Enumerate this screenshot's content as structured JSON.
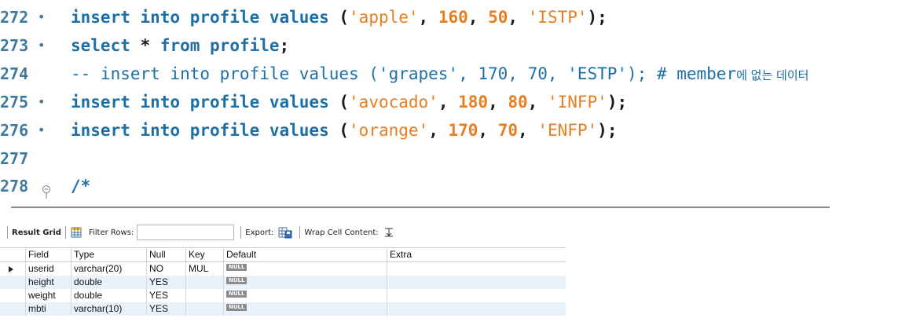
{
  "editor": {
    "lines": [
      {
        "number": "272",
        "marker": "•",
        "tokens": [
          {
            "t": "kw",
            "v": "insert into profile values "
          },
          {
            "t": "pn",
            "v": "("
          },
          {
            "t": "str",
            "v": "'apple'"
          },
          {
            "t": "pn",
            "v": ", "
          },
          {
            "t": "num",
            "v": "160"
          },
          {
            "t": "pn",
            "v": ", "
          },
          {
            "t": "num",
            "v": "50"
          },
          {
            "t": "pn",
            "v": ", "
          },
          {
            "t": "str",
            "v": "'ISTP'"
          },
          {
            "t": "pn",
            "v": ");"
          }
        ]
      },
      {
        "number": "273",
        "marker": "•",
        "tokens": [
          {
            "t": "kw",
            "v": "select "
          },
          {
            "t": "pn",
            "v": "* "
          },
          {
            "t": "kw",
            "v": "from profile"
          },
          {
            "t": "pn",
            "v": ";"
          }
        ]
      },
      {
        "number": "274",
        "marker": "",
        "tokens": [
          {
            "t": "cmt",
            "v": "-- insert into profile values ('grapes', 170, 70, 'ESTP'); # member"
          },
          {
            "t": "cmt-ko",
            "v": "에 없는 데이터"
          }
        ]
      },
      {
        "number": "275",
        "marker": "•",
        "tokens": [
          {
            "t": "kw",
            "v": "insert into profile values "
          },
          {
            "t": "pn",
            "v": "("
          },
          {
            "t": "str",
            "v": "'avocado'"
          },
          {
            "t": "pn",
            "v": ", "
          },
          {
            "t": "num",
            "v": "180"
          },
          {
            "t": "pn",
            "v": ", "
          },
          {
            "t": "num",
            "v": "80"
          },
          {
            "t": "pn",
            "v": ", "
          },
          {
            "t": "str",
            "v": "'INFP'"
          },
          {
            "t": "pn",
            "v": ");"
          }
        ]
      },
      {
        "number": "276",
        "marker": "•",
        "tokens": [
          {
            "t": "kw",
            "v": "insert into profile values "
          },
          {
            "t": "pn",
            "v": "("
          },
          {
            "t": "str",
            "v": "'orange'"
          },
          {
            "t": "pn",
            "v": ", "
          },
          {
            "t": "num",
            "v": "170"
          },
          {
            "t": "pn",
            "v": ", "
          },
          {
            "t": "num",
            "v": "70"
          },
          {
            "t": "pn",
            "v": ", "
          },
          {
            "t": "str",
            "v": "'ENFP'"
          },
          {
            "t": "pn",
            "v": ");"
          }
        ]
      },
      {
        "number": "277",
        "marker": "",
        "tokens": []
      },
      {
        "number": "278",
        "marker": "fold",
        "tokens": [
          {
            "t": "kw",
            "v": "/*"
          }
        ]
      }
    ]
  },
  "toolbar": {
    "result_grid_label": "Result Grid",
    "grid_icon": "grid-view-icon",
    "filter_rows_label": "Filter Rows:",
    "filter_rows_value": "",
    "export_label": "Export:",
    "export_icon": "export-icon",
    "wrap_label": "Wrap Cell Content:",
    "wrap_icon": "wrap-text-icon"
  },
  "grid": {
    "columns": [
      "Field",
      "Type",
      "Null",
      "Key",
      "Default",
      "Extra"
    ],
    "null_badge": "NULL",
    "rows": [
      {
        "field": "userid",
        "type": "varchar(20)",
        "null": "NO",
        "key": "MUL",
        "default": "NULL",
        "extra": "",
        "selected": true
      },
      {
        "field": "height",
        "type": "double",
        "null": "YES",
        "key": "",
        "default": "NULL",
        "extra": "",
        "selected": false
      },
      {
        "field": "weight",
        "type": "double",
        "null": "YES",
        "key": "",
        "default": "NULL",
        "extra": "",
        "selected": false
      },
      {
        "field": "mbti",
        "type": "varchar(10)",
        "null": "YES",
        "key": "",
        "default": "NULL",
        "extra": "",
        "selected": false
      }
    ]
  },
  "colors": {
    "keyword": "#1d6fa5",
    "string": "#e67e22",
    "line_number": "#3d7a9e",
    "alt_row": "#e9f1fb"
  }
}
